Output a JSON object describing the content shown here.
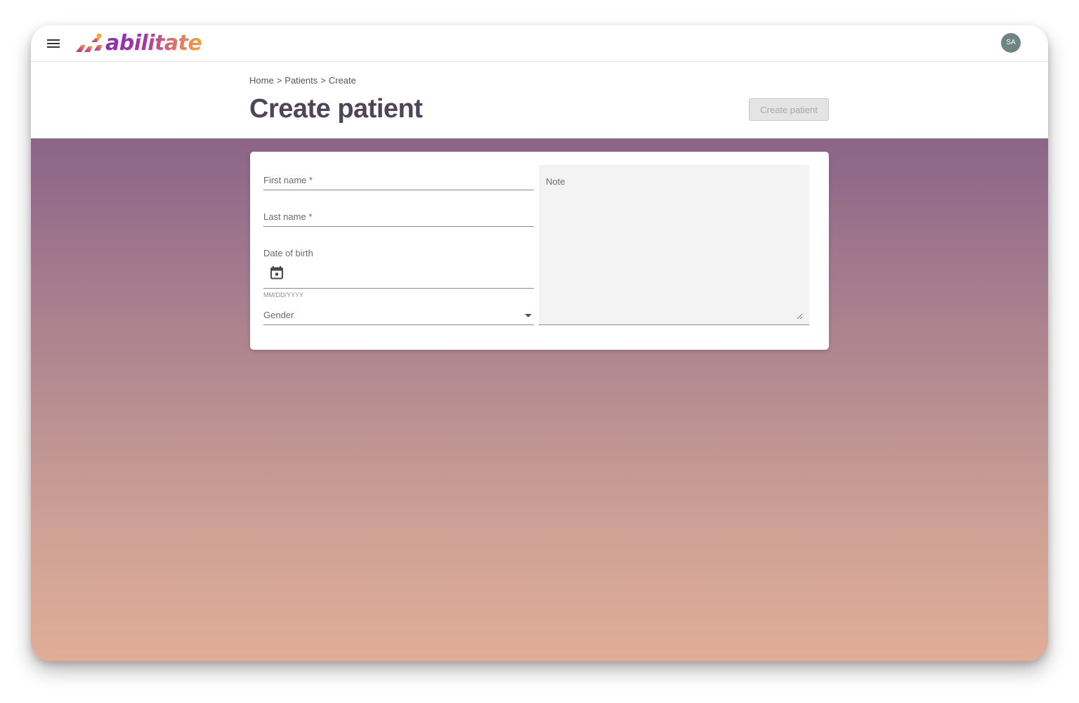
{
  "app": {
    "brand_name": "abilitate",
    "menu_icon": "hamburger-menu-icon",
    "user_initials": "SA",
    "colors": {
      "brand_purple": "#8e2bb5",
      "brand_orange": "#f2a33a",
      "title_text": "#4f4458",
      "background_top": "#8c6488",
      "background_bottom": "#e0ad96",
      "avatar_bg": "#6e8586"
    }
  },
  "breadcrumb": {
    "items": [
      "Home",
      "Patients",
      "Create"
    ],
    "separator": ">"
  },
  "page": {
    "title": "Create patient",
    "primary_action": "Create patient",
    "primary_action_enabled": false
  },
  "form": {
    "first_name": {
      "label": "First name *",
      "value": ""
    },
    "last_name": {
      "label": "Last name *",
      "value": ""
    },
    "date_of_birth": {
      "label": "Date of birth",
      "hint": "MM/DD/YYYY",
      "icon": "calendar-icon",
      "value": ""
    },
    "gender": {
      "label": "Gender",
      "icon": "dropdown-arrow-icon",
      "value": ""
    },
    "note": {
      "label": "Note",
      "value": ""
    }
  }
}
